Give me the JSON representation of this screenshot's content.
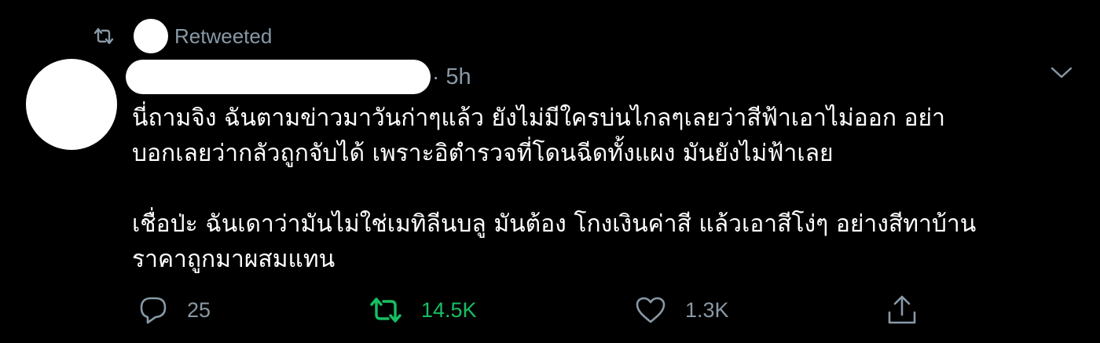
{
  "retweet_context": {
    "label": "Retweeted"
  },
  "tweet": {
    "timestamp": "5h",
    "separator": "·",
    "text_lines": [
      "นี่ถามจิง ฉันตามข่าวมาวันก่าๆแล้ว ยังไม่มีใครบ่นไกลๆเลยว่าสีฟ้าเอาไม่ออก อย่า",
      "บอกเลยว่ากลัวถูกจับได้ เพราะอิตำรวจที่โดนฉีดทั้งแผง มันยังไม่ฟ้าเลย",
      "",
      "เชื่อป่ะ ฉันเดาว่ามันไม่ใช่เมทิลีนบลู มันต้อง โกงเงินค่าสี แล้วเอาสีโง่ๆ อย่างสีทาบ้าน",
      "ราคาถูกมาผสมแทน"
    ]
  },
  "actions": {
    "reply_count": "25",
    "retweet_count": "14.5K",
    "like_count": "1.3K"
  },
  "icons": {
    "retweet_context": "retweet-icon",
    "caret": "chevron-down-icon",
    "reply": "reply-icon",
    "retweet": "retweet-icon",
    "like": "heart-icon",
    "share": "share-icon"
  },
  "colors": {
    "background": "#000000",
    "text": "#ffffff",
    "muted": "#8899a6",
    "retweet_active": "#17bf63"
  }
}
